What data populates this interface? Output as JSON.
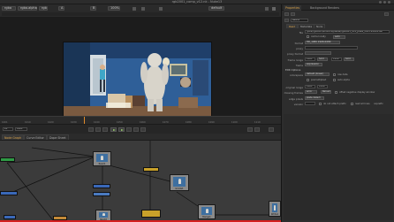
{
  "app": {
    "window_title": "rgb2001_comp_v12.nk - Nuke13"
  },
  "viewer_toolbar": {
    "channels": "rgba",
    "channel": "rgba.alpha",
    "layer": "rgb",
    "input_a": "A",
    "input_b": "B",
    "zoom": "100%",
    "colorspace": "default"
  },
  "viewer": {
    "bbox_text": "BBL 1920,1080 1920x1080  1920 x 1080  bbox: 1:1 1920 1080 channels: rgb",
    "frame_text": "x=0 y=0"
  },
  "timeline": {
    "ticks": [
      "1001",
      "1010",
      "1020",
      "1030",
      "1040",
      "1050",
      "1060",
      "1070",
      "1080",
      "1090",
      "1100",
      "1110"
    ],
    "current_frame": "1001",
    "fps": "24"
  },
  "node_graph": {
    "tabs": [
      "Node Graph",
      "Curve Editor",
      "Dope Sheet"
    ],
    "nodes": [
      {
        "label": "Read1"
      },
      {
        "label": "Read2"
      },
      {
        "label": "Grade1"
      },
      {
        "label": "Merge1"
      },
      {
        "label": "Write1"
      }
    ]
  },
  "properties": {
    "tabs": [
      "Properties",
      "Background Renders"
    ],
    "node_name": "Read1",
    "node_tabs": [
      "Read",
      "Metadata",
      "Node"
    ],
    "file_label": "file",
    "file_value": "/jobs/rgb2001/shot010/plates/rgb2001_010_plate_v001.####.exr",
    "cache_locally": "cache locally",
    "cache_mode": "auto",
    "format_label": "format",
    "format_value": "HD_1080 1920x1080",
    "proxy_label": "proxy",
    "proxy_format_label": "proxy format",
    "frame_range_label": "frame range",
    "frame_start": "1001",
    "frame_end": "1240",
    "hold_before": "hold",
    "hold_after": "hold",
    "frame_label": "frame",
    "frame_mode": "expression",
    "original_range_label": "original range",
    "orig_start": "1001",
    "orig_end": "1240",
    "missing_frames_label": "missing frames",
    "missing_frames": "error",
    "exr_options": "EXR Options",
    "colorspace_label": "colorspace",
    "colorspace_value": "default (linear)",
    "premultiplied": "premultiplied",
    "raw_data": "raw data",
    "auto_alpha": "auto alpha",
    "do_not_attach_prefix": "do not attach prefix",
    "edge_pixels_label": "edge pixels",
    "edge_pixels_value": "plate detect",
    "offset_negative": "offset negative display window",
    "version_label": "version",
    "reload": "Reload",
    "read_all_lines": "read all lines",
    "noprefix": "noprefix"
  },
  "colors": {
    "accent": "#d8a24a",
    "red_progress": "#d42020",
    "node_green": "#2f9a45",
    "node_blue": "#3a68b8",
    "node_gold": "#c9a12a"
  }
}
